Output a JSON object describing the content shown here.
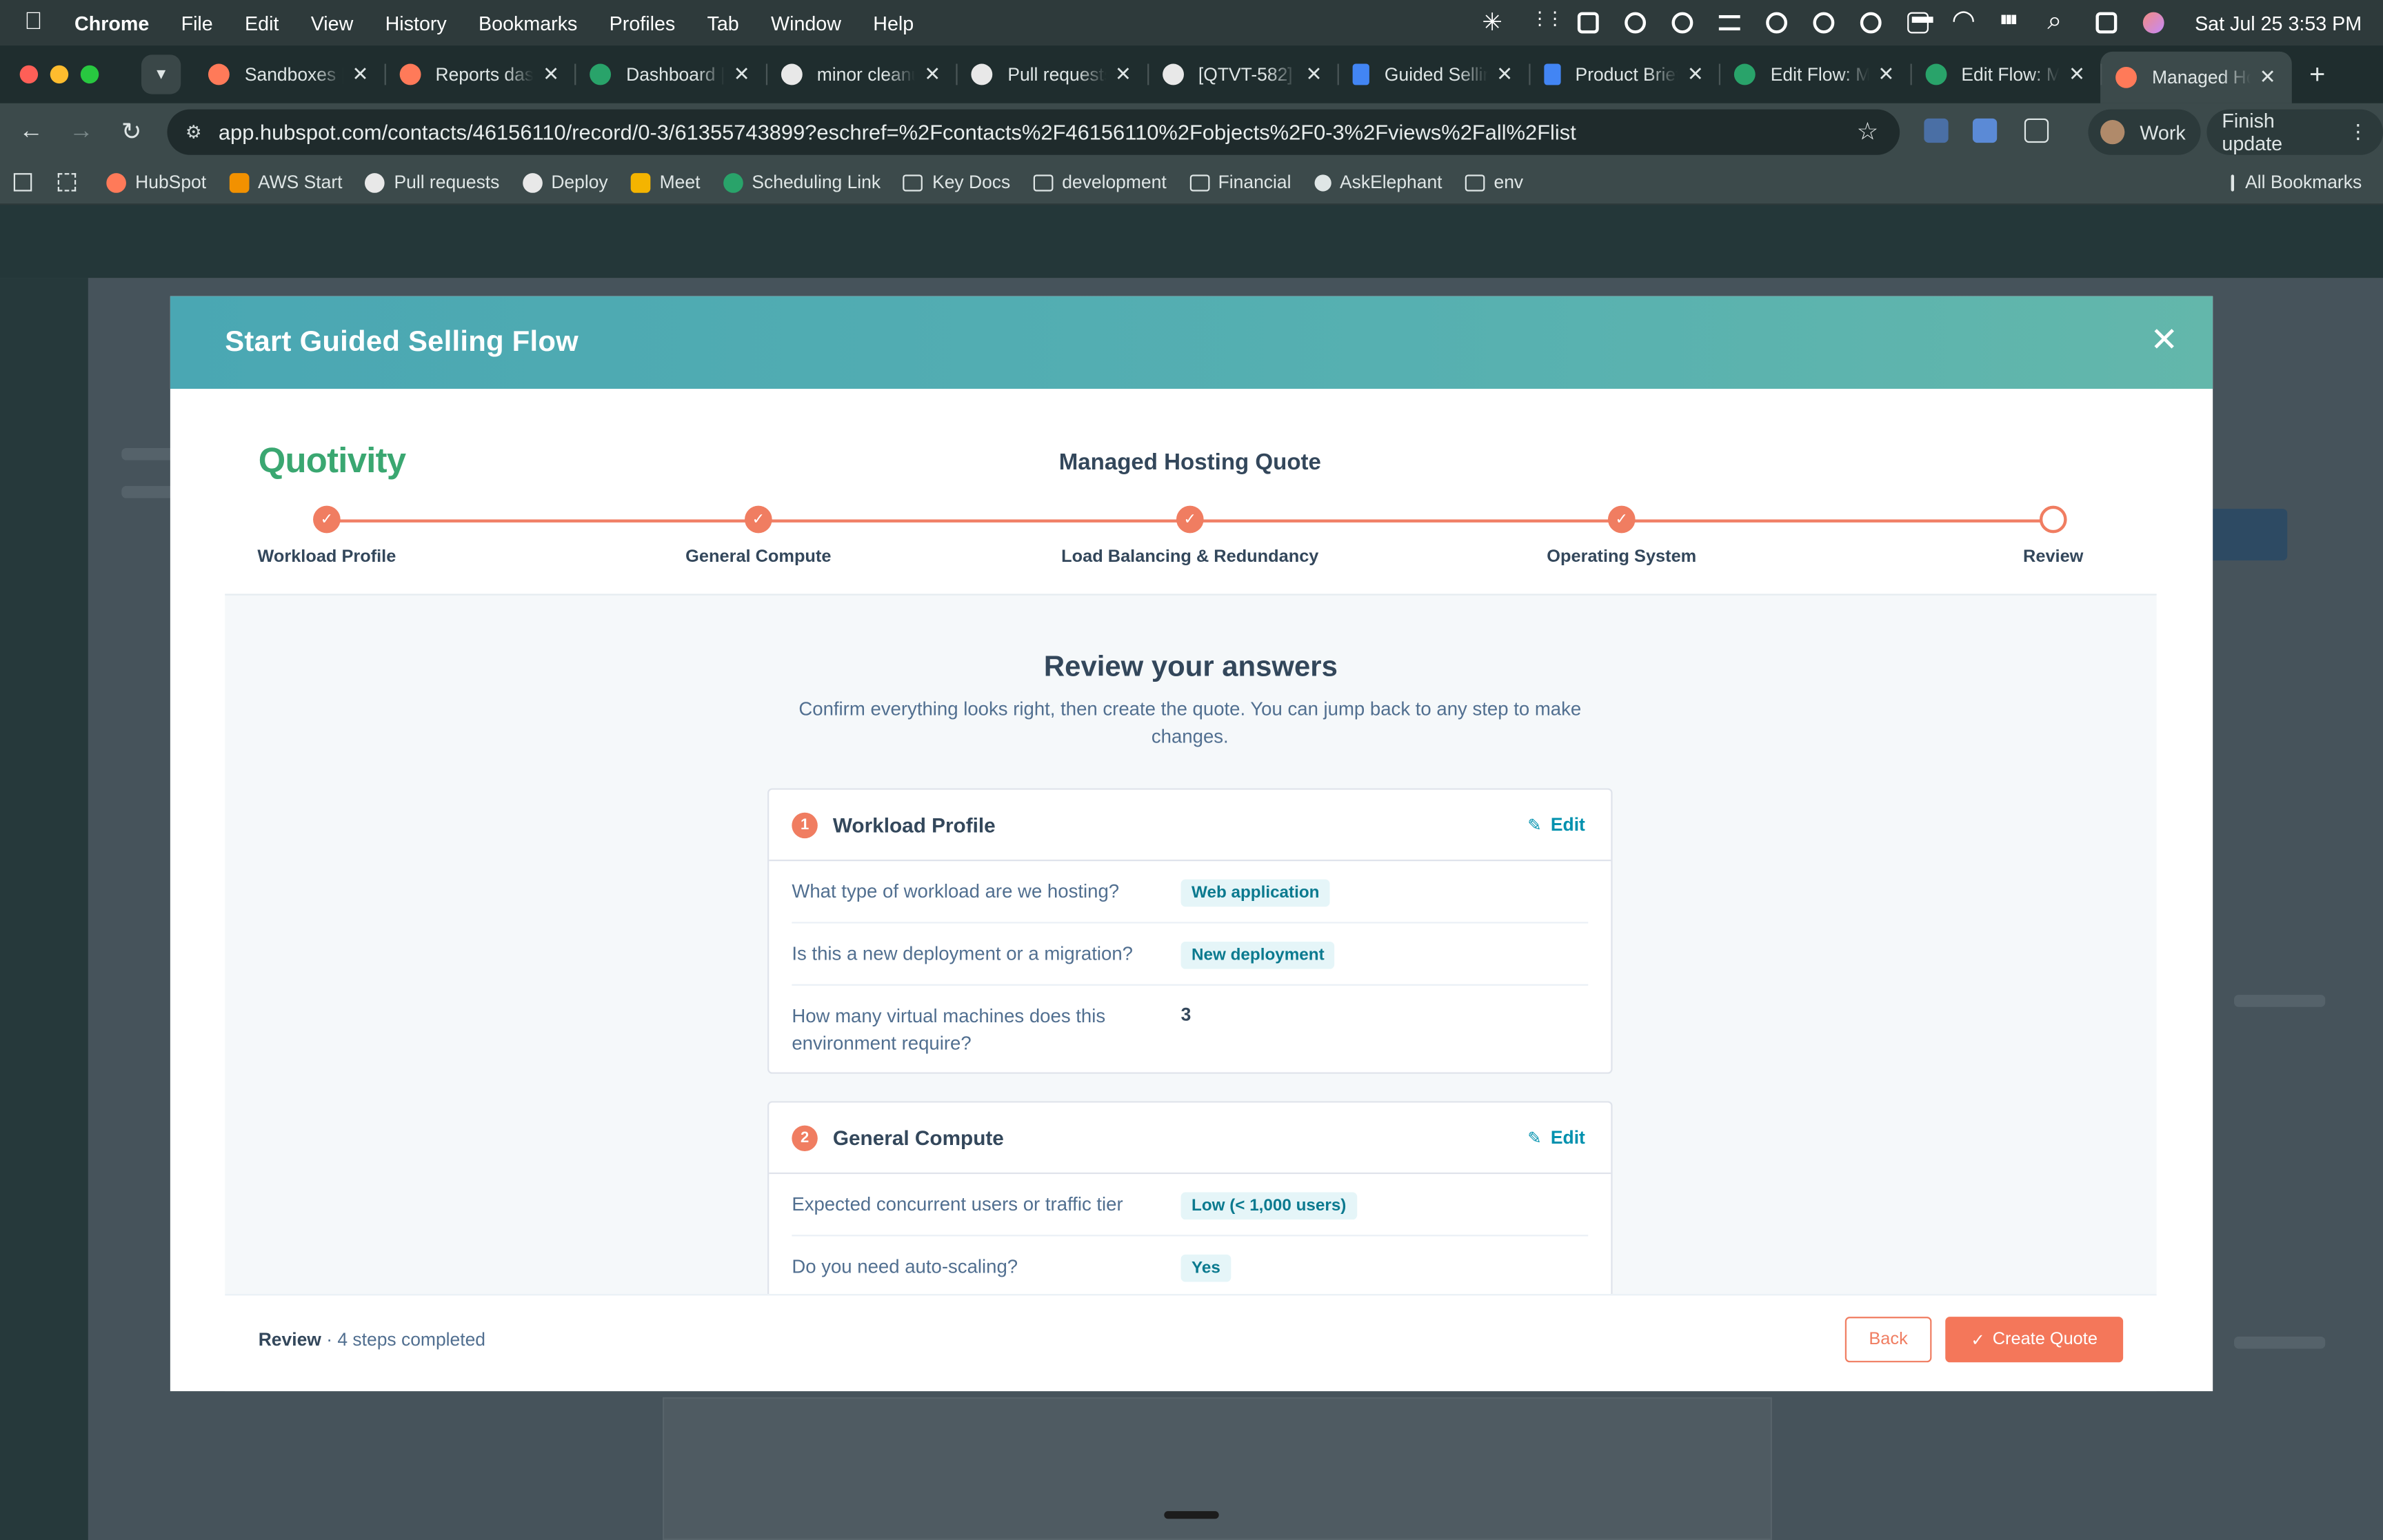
{
  "menubar": {
    "items": [
      "Chrome",
      "File",
      "Edit",
      "View",
      "History",
      "Bookmarks",
      "Profiles",
      "Tab",
      "Window",
      "Help"
    ],
    "clock": "Sat Jul 25  3:53 PM"
  },
  "tabs": [
    {
      "label": "Sandboxes | HubSpot",
      "favicon": "hubspot-icon"
    },
    {
      "label": "Reports dashboard",
      "favicon": "hubspot-icon"
    },
    {
      "label": "Dashboard | Quotivity",
      "favicon": "quotivity-icon"
    },
    {
      "label": "minor cleanup",
      "favicon": "github-icon"
    },
    {
      "label": "Pull requests",
      "favicon": "github-icon"
    },
    {
      "label": "[QTVT-582]",
      "favicon": "github-icon"
    },
    {
      "label": "Guided Selling",
      "favicon": "doc-icon"
    },
    {
      "label": "Product Brief",
      "favicon": "doc-icon"
    },
    {
      "label": "Edit Flow: Managed",
      "favicon": "quotivity-icon"
    },
    {
      "label": "Edit Flow: Managed",
      "favicon": "quotivity-icon"
    },
    {
      "label": "Managed Hosting",
      "favicon": "hubspot-icon",
      "active": true
    }
  ],
  "toolbar": {
    "url": "app.hubspot.com/contacts/46156110/record/0-3/61355743899?eschref=%2Fcontacts%2F46156110%2Fobjects%2F0-3%2Fviews%2Fall%2Flist",
    "profile": "Work",
    "finish_update": "Finish update"
  },
  "bookmarks": [
    {
      "label": "HubSpot",
      "icon": "hubspot-icon"
    },
    {
      "label": "AWS Start",
      "icon": "aws-icon"
    },
    {
      "label": "Pull requests",
      "icon": "github-icon"
    },
    {
      "label": "Deploy",
      "icon": "github-icon"
    },
    {
      "label": "Meet",
      "icon": "meet-icon"
    },
    {
      "label": "Scheduling Link",
      "icon": "quotivity-icon"
    },
    {
      "label": "Key Docs",
      "icon": "folder-icon"
    },
    {
      "label": "development",
      "icon": "folder-icon"
    },
    {
      "label": "Financial",
      "icon": "folder-icon"
    },
    {
      "label": "AskElephant",
      "icon": "askelephant-icon"
    },
    {
      "label": "env",
      "icon": "folder-icon"
    }
  ],
  "all_bookmarks": "All Bookmarks",
  "modal": {
    "title": "Start Guided Selling Flow",
    "brand": "Quotivity",
    "quote_name": "Managed Hosting Quote",
    "steps": [
      {
        "label": "Workload Profile",
        "state": "complete"
      },
      {
        "label": "General Compute",
        "state": "complete"
      },
      {
        "label": "Load Balancing & Redundancy",
        "state": "complete"
      },
      {
        "label": "Operating System",
        "state": "complete"
      },
      {
        "label": "Review",
        "state": "current"
      }
    ],
    "review": {
      "heading": "Review your answers",
      "subtitle": "Confirm everything looks right, then create the quote. You can jump back to any step to make changes.",
      "edit_label": "Edit",
      "sections": [
        {
          "number": "1",
          "title": "Workload Profile",
          "rows": [
            {
              "question": "What type of workload are we hosting?",
              "answer": "Web application",
              "tag": true
            },
            {
              "question": "Is this a new deployment or a migration?",
              "answer": "New deployment",
              "tag": true
            },
            {
              "question": "How many virtual machines does this environment require?",
              "answer": "3",
              "tag": false
            }
          ]
        },
        {
          "number": "2",
          "title": "General Compute",
          "rows": [
            {
              "question": "Expected concurrent users or traffic tier",
              "answer": "Low (< 1,000 users)",
              "tag": true
            },
            {
              "question": "Do you need auto-scaling?",
              "answer": "Yes",
              "tag": true
            }
          ]
        }
      ]
    },
    "footer": {
      "status_strong": "Review",
      "status_rest": " · 4 steps completed",
      "back_label": "Back",
      "create_label": "Create Quote"
    }
  },
  "colors": {
    "accent": "#f07d61",
    "header_teal": "#4aa7b3",
    "brand_green": "#3aa771",
    "link": "#0091ae"
  }
}
